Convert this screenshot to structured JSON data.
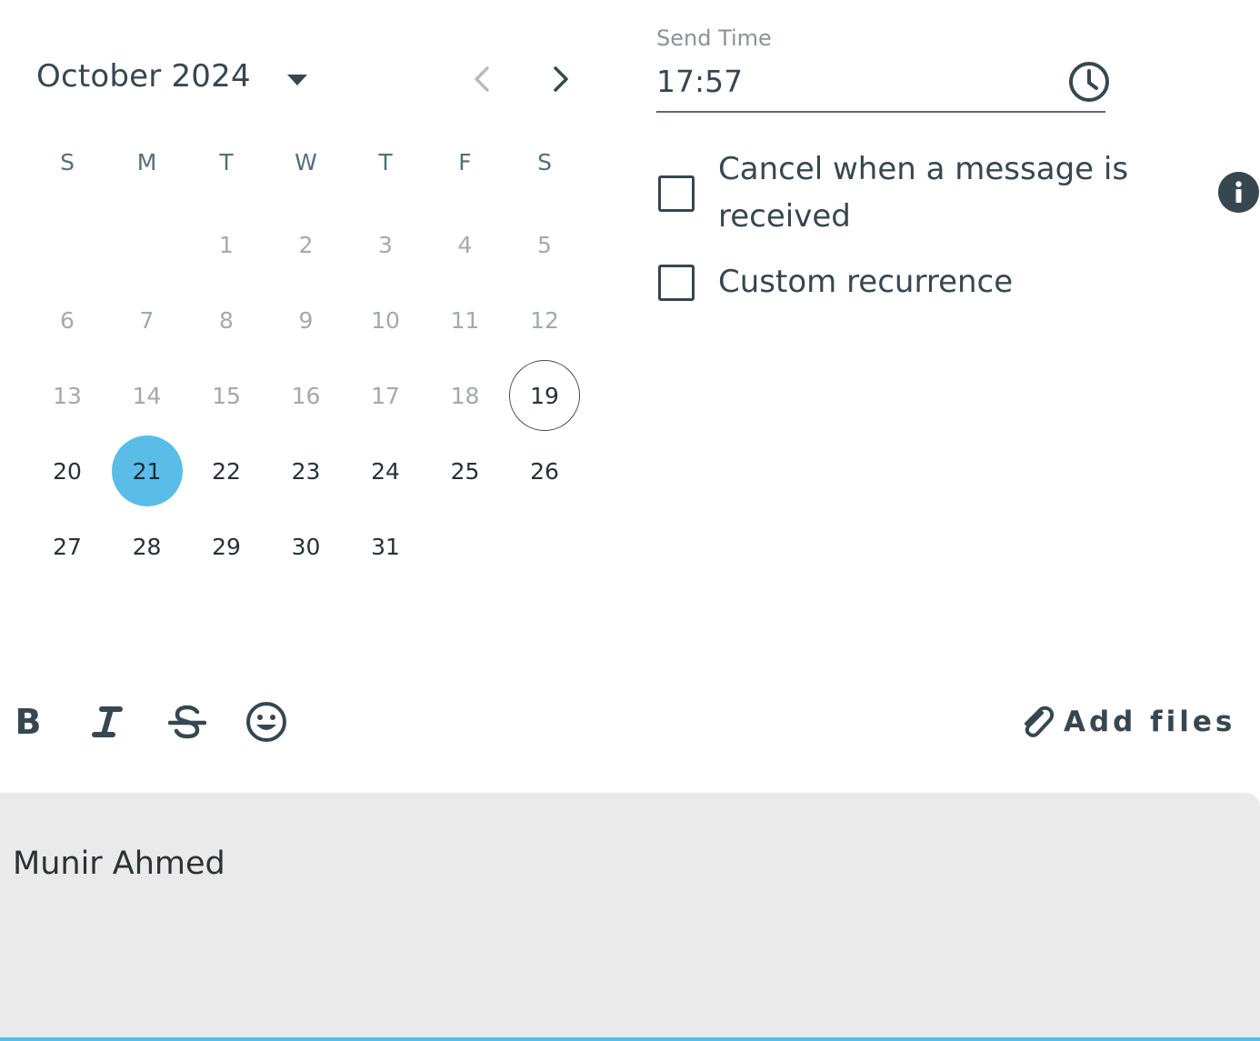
{
  "calendar": {
    "month_label": "October 2024",
    "weekdays": [
      "S",
      "M",
      "T",
      "W",
      "T",
      "F",
      "S"
    ],
    "weeks": [
      [
        "",
        "",
        "1",
        "2",
        "3",
        "4",
        "5"
      ],
      [
        "6",
        "7",
        "8",
        "9",
        "10",
        "11",
        "12"
      ],
      [
        "13",
        "14",
        "15",
        "16",
        "17",
        "18",
        "19"
      ],
      [
        "20",
        "21",
        "22",
        "23",
        "24",
        "25",
        "26"
      ],
      [
        "27",
        "28",
        "29",
        "30",
        "31",
        "",
        ""
      ]
    ],
    "today": "19",
    "selected": "21",
    "selected_color": "#59bde8",
    "prev_disabled": true
  },
  "send_time": {
    "label": "Send Time",
    "value": "17:57"
  },
  "options": {
    "cancel_on_message": {
      "label_line1": "Cancel when a message is",
      "label_line2": "received",
      "checked": false
    },
    "custom_recurrence": {
      "label": "Custom recurrence",
      "checked": false
    }
  },
  "toolbar": {
    "bold_label": "B",
    "add_files_label": "Add files",
    "icons": [
      "bold-icon",
      "italic-icon",
      "strikethrough-icon",
      "emoji-icon",
      "paperclip-icon"
    ]
  },
  "message": {
    "text": "Munir Ahmed",
    "focus_color": "#59bde8"
  },
  "colors": {
    "text": "#37474f",
    "disabled": "#a4a9ad",
    "message_bg": "#eaeaea"
  }
}
